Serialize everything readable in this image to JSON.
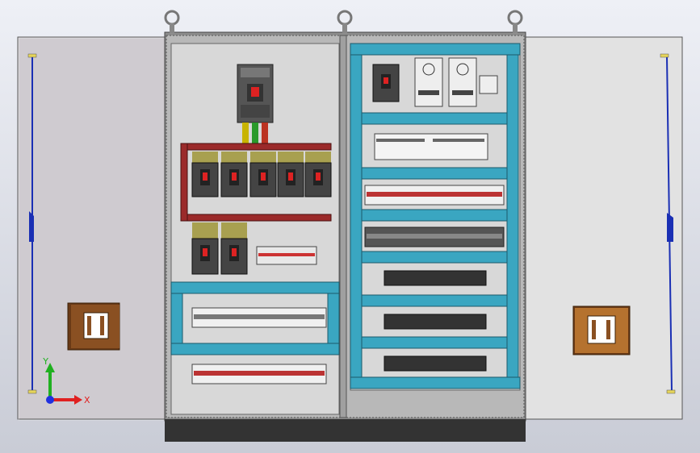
{
  "viewport": {
    "background_top": "#eef0f6",
    "background_bottom": "#c9ccd6"
  },
  "colors": {
    "door": "#dcdcdc",
    "door_shade": "#c2c2c2",
    "enclosure": "#9a9a9a",
    "mounting_plate": "#d4d4d4",
    "duct": "#3aa6c1",
    "busbar": "#9b2a2a",
    "handle": "#8a5022",
    "hinge_rod": "#1a2fb4",
    "base": "#333333"
  },
  "triad": {
    "x_label": "X",
    "y_label": "Y",
    "z_label": "",
    "x_color": "#e02020",
    "y_color": "#20b020",
    "z_color": "#2030e0"
  },
  "icons": [
    "lifting-eye-bolt-icon",
    "molded-case-breaker-icon",
    "terminal-block-icon",
    "power-supply-icon",
    "plc-module-icon",
    "door-handle-icon",
    "coordinate-triad-icon"
  ]
}
